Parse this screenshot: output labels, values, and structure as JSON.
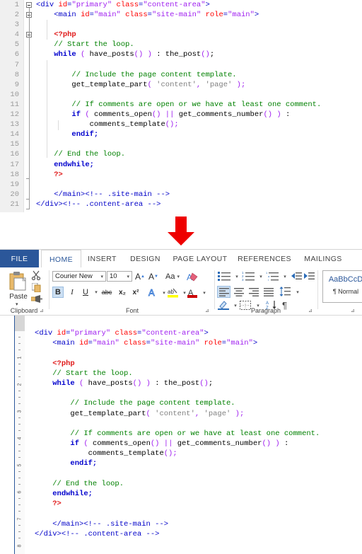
{
  "editor": {
    "name": "code-editor",
    "line_numbers": [
      "1",
      "2",
      "3",
      "4",
      "5",
      "6",
      "7",
      "8",
      "9",
      "10",
      "11",
      "12",
      "13",
      "14",
      "15",
      "16",
      "17",
      "18",
      "19",
      "20",
      "21"
    ],
    "lines": [
      {
        "n": "1",
        "indent": 0,
        "tokens": [
          {
            "t": "<",
            "c": "tag"
          },
          {
            "t": "div",
            "c": "tag"
          },
          {
            "t": " ",
            "c": "id"
          },
          {
            "t": "id",
            "c": "attr"
          },
          {
            "t": "=",
            "c": "tag"
          },
          {
            "t": "\"primary\"",
            "c": "val"
          },
          {
            "t": " ",
            "c": "id"
          },
          {
            "t": "class",
            "c": "attr"
          },
          {
            "t": "=",
            "c": "tag"
          },
          {
            "t": "\"content-area\"",
            "c": "val"
          },
          {
            "t": ">",
            "c": "tag"
          }
        ]
      },
      {
        "n": "2",
        "indent": 4,
        "tokens": [
          {
            "t": "<",
            "c": "tag"
          },
          {
            "t": "main",
            "c": "tag"
          },
          {
            "t": " ",
            "c": "id"
          },
          {
            "t": "id",
            "c": "attr"
          },
          {
            "t": "=",
            "c": "tag"
          },
          {
            "t": "\"main\"",
            "c": "val"
          },
          {
            "t": " ",
            "c": "id"
          },
          {
            "t": "class",
            "c": "attr"
          },
          {
            "t": "=",
            "c": "tag"
          },
          {
            "t": "\"site-main\"",
            "c": "val"
          },
          {
            "t": " ",
            "c": "id"
          },
          {
            "t": "role",
            "c": "attr"
          },
          {
            "t": "=",
            "c": "tag"
          },
          {
            "t": "\"main\"",
            "c": "val"
          },
          {
            "t": ">",
            "c": "tag"
          }
        ]
      },
      {
        "n": "3",
        "indent": 0,
        "tokens": []
      },
      {
        "n": "4",
        "indent": 4,
        "tokens": [
          {
            "t": "<?php",
            "c": "php"
          }
        ]
      },
      {
        "n": "5",
        "indent": 4,
        "tokens": [
          {
            "t": "// Start the loop.",
            "c": "com"
          }
        ]
      },
      {
        "n": "6",
        "indent": 4,
        "tokens": [
          {
            "t": "while",
            "c": "kw"
          },
          {
            "t": " ",
            "c": "id"
          },
          {
            "t": "(",
            "c": "pun"
          },
          {
            "t": " have_posts",
            "c": "id"
          },
          {
            "t": "()",
            "c": "pun"
          },
          {
            "t": " ",
            "c": "id"
          },
          {
            "t": ")",
            "c": "pun"
          },
          {
            "t": " : the_post",
            "c": "id"
          },
          {
            "t": "()",
            "c": "pun"
          },
          {
            "t": ";",
            "c": "id"
          }
        ]
      },
      {
        "n": "7",
        "indent": 0,
        "tokens": []
      },
      {
        "n": "8",
        "indent": 8,
        "tokens": [
          {
            "t": "// Include the page content template.",
            "c": "com"
          }
        ]
      },
      {
        "n": "9",
        "indent": 8,
        "tokens": [
          {
            "t": "get_template_part",
            "c": "id"
          },
          {
            "t": "(",
            "c": "pun"
          },
          {
            "t": " ",
            "c": "id"
          },
          {
            "t": "'content'",
            "c": "str"
          },
          {
            "t": ",",
            "c": "pun"
          },
          {
            "t": " ",
            "c": "id"
          },
          {
            "t": "'page'",
            "c": "str"
          },
          {
            "t": " ",
            "c": "id"
          },
          {
            "t": ");",
            "c": "pun"
          }
        ]
      },
      {
        "n": "10",
        "indent": 0,
        "tokens": []
      },
      {
        "n": "11",
        "indent": 8,
        "tokens": [
          {
            "t": "// If comments are open or we have at least one comment.",
            "c": "com"
          }
        ]
      },
      {
        "n": "12",
        "indent": 8,
        "tokens": [
          {
            "t": "if",
            "c": "kw"
          },
          {
            "t": " ",
            "c": "id"
          },
          {
            "t": "(",
            "c": "pun"
          },
          {
            "t": " comments_open",
            "c": "id"
          },
          {
            "t": "()",
            "c": "pun"
          },
          {
            "t": " ",
            "c": "id"
          },
          {
            "t": "||",
            "c": "pun"
          },
          {
            "t": " get_comments_number",
            "c": "id"
          },
          {
            "t": "()",
            "c": "pun"
          },
          {
            "t": " ",
            "c": "id"
          },
          {
            "t": ")",
            "c": "pun"
          },
          {
            "t": " :",
            "c": "id"
          }
        ]
      },
      {
        "n": "13",
        "indent": 12,
        "tokens": [
          {
            "t": "comments_template",
            "c": "id"
          },
          {
            "t": "();",
            "c": "pun"
          }
        ]
      },
      {
        "n": "14",
        "indent": 8,
        "tokens": [
          {
            "t": "endif;",
            "c": "kw"
          }
        ]
      },
      {
        "n": "15",
        "indent": 0,
        "tokens": []
      },
      {
        "n": "16",
        "indent": 4,
        "tokens": [
          {
            "t": "// End the loop.",
            "c": "com"
          }
        ]
      },
      {
        "n": "17",
        "indent": 4,
        "tokens": [
          {
            "t": "endwhile;",
            "c": "kw"
          }
        ]
      },
      {
        "n": "18",
        "indent": 4,
        "tokens": [
          {
            "t": "?>",
            "c": "php"
          }
        ]
      },
      {
        "n": "19",
        "indent": 0,
        "tokens": []
      },
      {
        "n": "20",
        "indent": 4,
        "tokens": [
          {
            "t": "</main>",
            "c": "tag"
          },
          {
            "t": "<!-- .site-main -->",
            "c": "htmlcom"
          }
        ]
      },
      {
        "n": "21",
        "indent": 0,
        "tokens": [
          {
            "t": "</div>",
            "c": "tag"
          },
          {
            "t": "<!-- .content-area -->",
            "c": "htmlcom"
          }
        ]
      }
    ]
  },
  "arrow": {
    "name": "down-arrow",
    "color": "#ee0000"
  },
  "word": {
    "tabs": [
      {
        "label": "FILE",
        "active": false,
        "file": true
      },
      {
        "label": "HOME",
        "active": true
      },
      {
        "label": "INSERT",
        "active": false
      },
      {
        "label": "DESIGN",
        "active": false
      },
      {
        "label": "PAGE LAYOUT",
        "active": false
      },
      {
        "label": "REFERENCES",
        "active": false
      },
      {
        "label": "MAILINGS",
        "active": false
      }
    ],
    "groups": {
      "clipboard": {
        "label": "Clipboard",
        "paste": "Paste"
      },
      "font": {
        "label": "Font",
        "font_name": "Courier New",
        "font_size": "10",
        "bold": "B",
        "italic": "I",
        "underline": "U",
        "strikethrough": "abc",
        "subscript": "x₂",
        "superscript": "x²",
        "change_case": "Aa",
        "clear_formatting": "clear-formatting",
        "grow": "A",
        "shrink": "A",
        "text_effects": "A",
        "highlight": "ab",
        "font_color": "A"
      },
      "paragraph": {
        "label": "Paragraph"
      },
      "styles": {
        "preview": "AaBbCcD",
        "name": "¶ Normal"
      }
    }
  },
  "document": {
    "ruler_numbers": [
      "1",
      "2",
      "3",
      "4",
      "5",
      "6",
      "7",
      "8"
    ],
    "lines": [
      {
        "indent": 0,
        "tokens": [
          {
            "t": "<",
            "c": "tag"
          },
          {
            "t": "div",
            "c": "tag"
          },
          {
            "t": " ",
            "c": "id"
          },
          {
            "t": "id",
            "c": "attr"
          },
          {
            "t": "=",
            "c": "tag"
          },
          {
            "t": "\"primary\"",
            "c": "val"
          },
          {
            "t": " ",
            "c": "id"
          },
          {
            "t": "class",
            "c": "attr"
          },
          {
            "t": "=",
            "c": "tag"
          },
          {
            "t": "\"content-area\"",
            "c": "val"
          },
          {
            "t": ">",
            "c": "tag"
          }
        ]
      },
      {
        "indent": 4,
        "tokens": [
          {
            "t": "<",
            "c": "tag"
          },
          {
            "t": "main",
            "c": "tag"
          },
          {
            "t": " ",
            "c": "id"
          },
          {
            "t": "id",
            "c": "attr"
          },
          {
            "t": "=",
            "c": "tag"
          },
          {
            "t": "\"main\"",
            "c": "val"
          },
          {
            "t": " ",
            "c": "id"
          },
          {
            "t": "class",
            "c": "attr"
          },
          {
            "t": "=",
            "c": "tag"
          },
          {
            "t": "\"site-main\"",
            "c": "val"
          },
          {
            "t": " ",
            "c": "id"
          },
          {
            "t": "role",
            "c": "attr"
          },
          {
            "t": "=",
            "c": "tag"
          },
          {
            "t": "\"main\"",
            "c": "val"
          },
          {
            "t": ">",
            "c": "tag"
          }
        ]
      },
      {
        "indent": 0,
        "tokens": []
      },
      {
        "indent": 4,
        "tokens": [
          {
            "t": "<?php",
            "c": "php"
          }
        ]
      },
      {
        "indent": 4,
        "tokens": [
          {
            "t": "// Start the loop.",
            "c": "com"
          }
        ]
      },
      {
        "indent": 4,
        "tokens": [
          {
            "t": "while",
            "c": "kw"
          },
          {
            "t": " ",
            "c": "id"
          },
          {
            "t": "(",
            "c": "pun"
          },
          {
            "t": " have_posts",
            "c": "id"
          },
          {
            "t": "()",
            "c": "pun"
          },
          {
            "t": " ",
            "c": "id"
          },
          {
            "t": ")",
            "c": "pun"
          },
          {
            "t": " : the_post",
            "c": "id"
          },
          {
            "t": "()",
            "c": "pun"
          },
          {
            "t": ";",
            "c": "id"
          }
        ]
      },
      {
        "indent": 0,
        "tokens": []
      },
      {
        "indent": 8,
        "tokens": [
          {
            "t": "// Include the page content template.",
            "c": "com"
          }
        ]
      },
      {
        "indent": 8,
        "tokens": [
          {
            "t": "get_template_part",
            "c": "id"
          },
          {
            "t": "(",
            "c": "pun"
          },
          {
            "t": " ",
            "c": "id"
          },
          {
            "t": "'content'",
            "c": "str"
          },
          {
            "t": ",",
            "c": "pun"
          },
          {
            "t": " ",
            "c": "id"
          },
          {
            "t": "'page'",
            "c": "str"
          },
          {
            "t": " ",
            "c": "id"
          },
          {
            "t": ");",
            "c": "pun"
          }
        ]
      },
      {
        "indent": 0,
        "tokens": []
      },
      {
        "indent": 8,
        "tokens": [
          {
            "t": "// If comments are open or we have at least one comment.",
            "c": "com"
          }
        ]
      },
      {
        "indent": 8,
        "tokens": [
          {
            "t": "if",
            "c": "kw"
          },
          {
            "t": " ",
            "c": "id"
          },
          {
            "t": "(",
            "c": "pun"
          },
          {
            "t": " comments_open",
            "c": "id"
          },
          {
            "t": "()",
            "c": "pun"
          },
          {
            "t": " ",
            "c": "id"
          },
          {
            "t": "||",
            "c": "pun"
          },
          {
            "t": " get_comments_number",
            "c": "id"
          },
          {
            "t": "()",
            "c": "pun"
          },
          {
            "t": " ",
            "c": "id"
          },
          {
            "t": ")",
            "c": "pun"
          },
          {
            "t": " :",
            "c": "id"
          }
        ]
      },
      {
        "indent": 12,
        "tokens": [
          {
            "t": "comments_template",
            "c": "id"
          },
          {
            "t": "();",
            "c": "pun"
          }
        ]
      },
      {
        "indent": 8,
        "tokens": [
          {
            "t": "endif;",
            "c": "kw"
          }
        ]
      },
      {
        "indent": 0,
        "tokens": []
      },
      {
        "indent": 4,
        "tokens": [
          {
            "t": "// End the loop.",
            "c": "com"
          }
        ]
      },
      {
        "indent": 4,
        "tokens": [
          {
            "t": "endwhile;",
            "c": "kw"
          }
        ]
      },
      {
        "indent": 4,
        "tokens": [
          {
            "t": "?>",
            "c": "php"
          }
        ]
      },
      {
        "indent": 0,
        "tokens": []
      },
      {
        "indent": 4,
        "tokens": [
          {
            "t": "</main>",
            "c": "tag"
          },
          {
            "t": "<!-- .site-main -->",
            "c": "htmlcom"
          }
        ]
      },
      {
        "indent": 0,
        "tokens": [
          {
            "t": "</div>",
            "c": "tag"
          },
          {
            "t": "<!-- .content-area -->",
            "c": "htmlcom"
          }
        ]
      }
    ]
  }
}
